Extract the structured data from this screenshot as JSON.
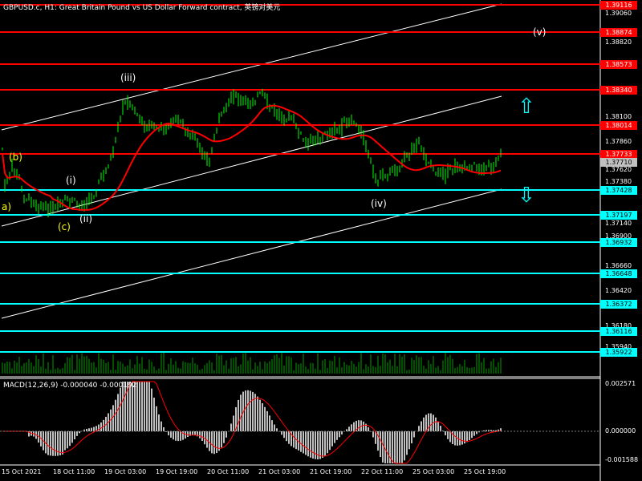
{
  "chart": {
    "title": "GBPUSD.c, H1:  Great Britain Pound vs US Dollar Forward contract, 英镑对美元",
    "macd_label": "MACD(12,26,9) -0.000040 -0.000192",
    "price_axis_labels": [
      "1.39060",
      "1.38820",
      "1.38580",
      "1.38340",
      "1.38100",
      "1.37860",
      "1.37620",
      "1.37380",
      "1.37140",
      "1.36900",
      "1.36660",
      "1.36420",
      "1.36180",
      "1.35940"
    ],
    "macd_axis_labels": [
      "0.002571",
      "0.000000",
      "-0.001588"
    ],
    "time_labels": [
      "15 Oct 2021",
      "18 Oct 11:00",
      "19 Oct 03:00",
      "19 Oct 19:00",
      "20 Oct 11:00",
      "21 Oct 03:00",
      "21 Oct 19:00",
      "22 Oct 11:00",
      "25 Oct 03:00",
      "25 Oct 19:00"
    ],
    "red_levels": [
      "1.39116",
      "1.38874",
      "1.38573",
      "1.38340",
      "1.38014",
      "1.37733"
    ],
    "cyan_levels": [
      "1.37428",
      "1.37197",
      "1.36932",
      "1.36648",
      "1.36372",
      "1.36116",
      "1.35922"
    ],
    "current_price_tag": "1.37710",
    "wave_labels": {
      "iii": "(iii)",
      "iv": "(iv)",
      "v": "(v)",
      "i": "(i)",
      "ii": "(ii)",
      "b": "(b)",
      "a": "a)",
      "c": "(c)"
    },
    "colors": {
      "background": "#000000",
      "candles": "#00ff00",
      "red_level": "#ff0000",
      "cyan_level": "#00ffff",
      "channel": "#ffffff",
      "ma": "#ff0000",
      "macd_hist": "#c0c0c0",
      "macd_signal": "#ff0000",
      "volume": "#00a000"
    },
    "icons": {
      "up_arrow": "up-arrow-icon",
      "down_arrow": "down-arrow-icon"
    }
  }
}
